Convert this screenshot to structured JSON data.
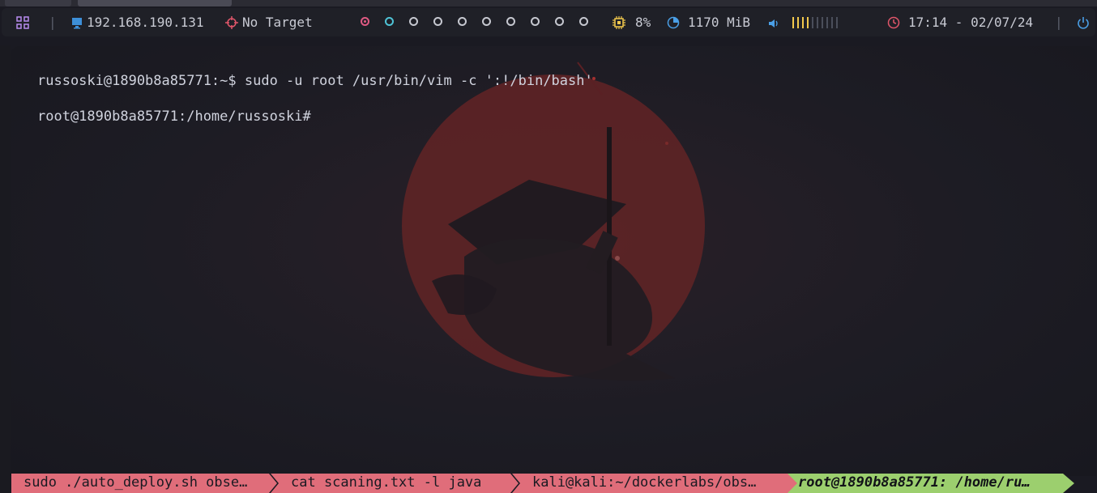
{
  "statusbar": {
    "launcher_icon": "grid-icon",
    "ip_icon": "monitor-icon",
    "ip_address": "192.168.190.131",
    "target_icon": "crosshair-icon",
    "target_label": "No Target",
    "workspaces": [
      {
        "state": "active"
      },
      {
        "state": "occupied"
      },
      {
        "state": "empty"
      },
      {
        "state": "empty"
      },
      {
        "state": "empty"
      },
      {
        "state": "empty"
      },
      {
        "state": "empty"
      },
      {
        "state": "empty"
      },
      {
        "state": "empty"
      },
      {
        "state": "empty"
      }
    ],
    "cpu_icon": "cpu-icon",
    "cpu_usage": "8%",
    "memory_icon": "pie-chart-icon",
    "memory_usage": "1170 MiB",
    "volume_icon": "speaker-icon",
    "volume_level": 0.4,
    "clock_icon": "clock-icon",
    "datetime": "17:14 - 02/07/24",
    "power_icon": "power-icon"
  },
  "terminal": {
    "lines": [
      "russoski@1890b8a85771:~$ sudo -u root /usr/bin/vim -c ':!/bin/bash'",
      "root@1890b8a85771:/home/russoski#"
    ]
  },
  "tabs": [
    {
      "title": "sudo ./auto_deploy.sh obse…",
      "active": false
    },
    {
      "title": "cat scaning.txt -l java",
      "active": false
    },
    {
      "title": "kali@kali:~/dockerlabs/obs…",
      "active": false
    },
    {
      "title": "root@1890b8a85771: /home/ru…",
      "active": true
    }
  ],
  "colors": {
    "accent_pink": "#e05a83",
    "accent_cyan": "#4fc3d6",
    "tab_inactive": "#e06d7a",
    "tab_active": "#9ccf6e",
    "volume_on": "#f2c94c",
    "background_art_red": "#6e2a2c"
  }
}
